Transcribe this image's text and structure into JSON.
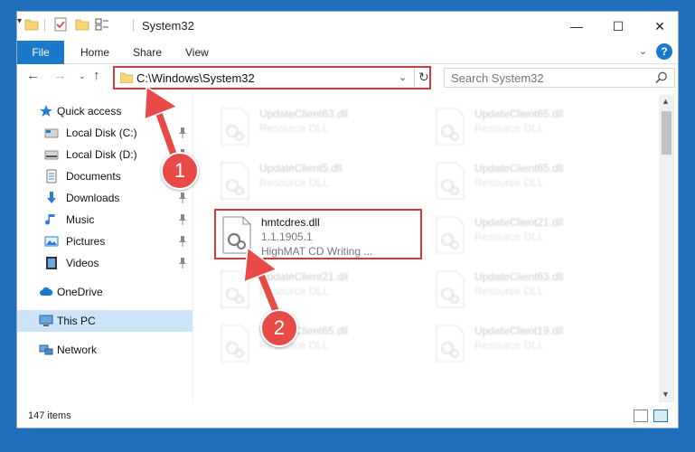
{
  "window": {
    "title": "System32",
    "minimize_glyph": "—",
    "maximize_glyph": "☐",
    "close_glyph": "✕"
  },
  "ribbon": {
    "file": "File",
    "home": "Home",
    "share": "Share",
    "view": "View",
    "collapse_glyph": "⌄",
    "help_glyph": "?"
  },
  "nav": {
    "back_glyph": "←",
    "forward_glyph": "→",
    "recent_glyph": "⌄",
    "up_glyph": "↑",
    "address": "C:\\Windows\\System32",
    "address_drop_glyph": "⌄",
    "refresh_glyph": "↻",
    "search_placeholder": "Search System32"
  },
  "sidebar": {
    "items": [
      {
        "label": "Quick access",
        "icon": "star-icon"
      },
      {
        "label": "Local Disk (C:)",
        "icon": "drive-icon",
        "pinned": true
      },
      {
        "label": "Local Disk (D:)",
        "icon": "drive-icon",
        "pinned": true
      },
      {
        "label": "Documents",
        "icon": "documents-icon"
      },
      {
        "label": "Downloads",
        "icon": "downloads-icon",
        "pinned": true
      },
      {
        "label": "Music",
        "icon": "music-icon",
        "pinned": true
      },
      {
        "label": "Pictures",
        "icon": "pictures-icon",
        "pinned": true
      },
      {
        "label": "Videos",
        "icon": "videos-icon",
        "pinned": true
      },
      {
        "label": "OneDrive",
        "icon": "cloud-icon"
      },
      {
        "label": "This PC",
        "icon": "computer-icon",
        "selected": true
      },
      {
        "label": "Network",
        "icon": "network-icon"
      }
    ]
  },
  "files": [
    {
      "name": "UpdateClient63.dll",
      "desc": "Resource DLL"
    },
    {
      "name": "UpdateClient65.dll",
      "desc": "Resource DLL"
    },
    {
      "name": "UpdateClient5.dll",
      "desc": "Resource DLL"
    },
    {
      "name": "UpdateClient65.dll",
      "desc": "Resource DLL"
    },
    {
      "name": "hmtcdres.dll",
      "desc": "1.1.1905.1",
      "extra": "HighMAT CD Writing ..."
    },
    {
      "name": "UpdateClient21.dll",
      "desc": "Resource DLL"
    },
    {
      "name": "UpdateClient21.dll",
      "desc": "Resource DLL"
    },
    {
      "name": "UpdateClient63.dll",
      "desc": "Resource DLL"
    },
    {
      "name": "UpdateClient65.dll",
      "desc": "Resource DLL"
    },
    {
      "name": "UpdateClient19.dll",
      "desc": "Resource DLL"
    }
  ],
  "status": {
    "item_count": "147 items"
  },
  "annotations": {
    "step1": "1",
    "step2": "2"
  },
  "colors": {
    "accent": "#1979ca",
    "annotation_red": "#e84b47",
    "highlight_border": "#d9383a",
    "selected_bg": "#cce4f7",
    "folder_yellow": "#f8d775"
  }
}
